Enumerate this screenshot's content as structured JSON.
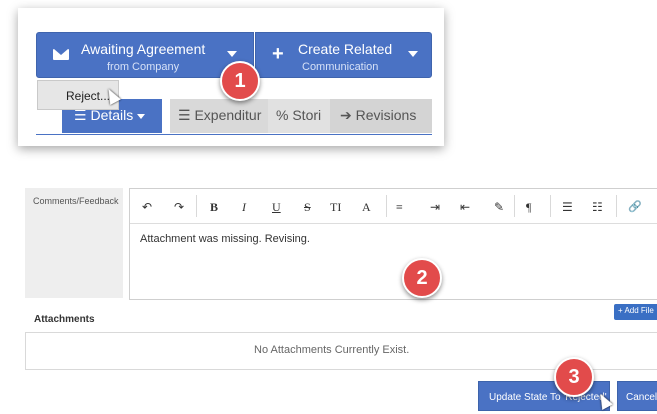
{
  "top_card": {
    "awaiting_button": {
      "label": "Awaiting Agreement",
      "sublabel": "from Company"
    },
    "create_button": {
      "label": "Create Related",
      "sublabel": "Communication"
    },
    "reject_option": "Reject...",
    "tabs": [
      {
        "label": "Details"
      },
      {
        "label": "Expenditur"
      },
      {
        "label": "Stori"
      },
      {
        "label": "Revisions"
      }
    ]
  },
  "badges": [
    "1",
    "2",
    "3"
  ],
  "comments": {
    "label": "Comments/Feedback",
    "toolbar": [
      "↶",
      "↷",
      "B",
      "I",
      "U",
      "S",
      "TI",
      "A",
      "≡",
      "⇥",
      "⇤",
      "✎",
      "¶",
      "☰",
      "☷",
      "🔗"
    ],
    "text": "Attachment was missing. Revising."
  },
  "attachments": {
    "label": "Attachments",
    "add_button": "Add File",
    "empty_text": "No Attachments Currently Exist."
  },
  "footer": {
    "update_button": "Update State To 'Rejected'",
    "cancel_button": "Cancel"
  },
  "colors": {
    "primary": "#4a72c4",
    "badge": "#e24b4b"
  }
}
